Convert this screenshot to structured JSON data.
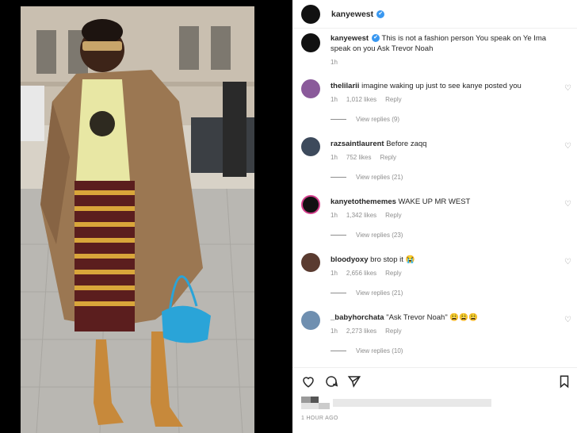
{
  "post": {
    "username": "kanyewest",
    "verified": "✔"
  },
  "caption": {
    "username": "kanyewest",
    "text": "This is not a fashion person You speak on Ye Ima speak on you Ask Trevor Noah",
    "age": "1h"
  },
  "comments": [
    {
      "username": "thelilarii",
      "text": "imagine waking up just to see kanye posted you",
      "age": "1h",
      "likes": "1,012 likes",
      "reply": "Reply",
      "replies": "View replies (9)",
      "avatar_color": "#8a5a9a"
    },
    {
      "username": "razsaintlaurent",
      "text": "Before zaqq",
      "age": "1h",
      "likes": "752 likes",
      "reply": "Reply",
      "replies": "View replies (21)",
      "avatar_color": "#3d4a5c"
    },
    {
      "username": "kanyetothememes",
      "text": "WAKE UP MR WEST",
      "age": "1h",
      "likes": "1,342 likes",
      "reply": "Reply",
      "replies": "View replies (23)",
      "avatar_color": "#111111"
    },
    {
      "username": "bloodyoxy",
      "text": "bro stop it 😭",
      "age": "1h",
      "likes": "2,656 likes",
      "reply": "Reply",
      "replies": "View replies (21)",
      "avatar_color": "#5a3b30"
    },
    {
      "username": "_babyhorchata",
      "text": "\"Ask Trevor Noah\" 😩😩😩",
      "age": "1h",
      "likes": "2,273 likes",
      "reply": "Reply",
      "replies": "View replies (10)",
      "avatar_color": "#6f8fb0"
    }
  ],
  "footer": {
    "timestamp": "1 HOUR AGO"
  },
  "icons": [
    "heart-icon",
    "comment-icon",
    "share-icon",
    "bookmark-icon",
    "verified-icon"
  ],
  "colors": {
    "verified": "#3897f0",
    "muted": "#8e8e8e",
    "text": "#262626"
  }
}
